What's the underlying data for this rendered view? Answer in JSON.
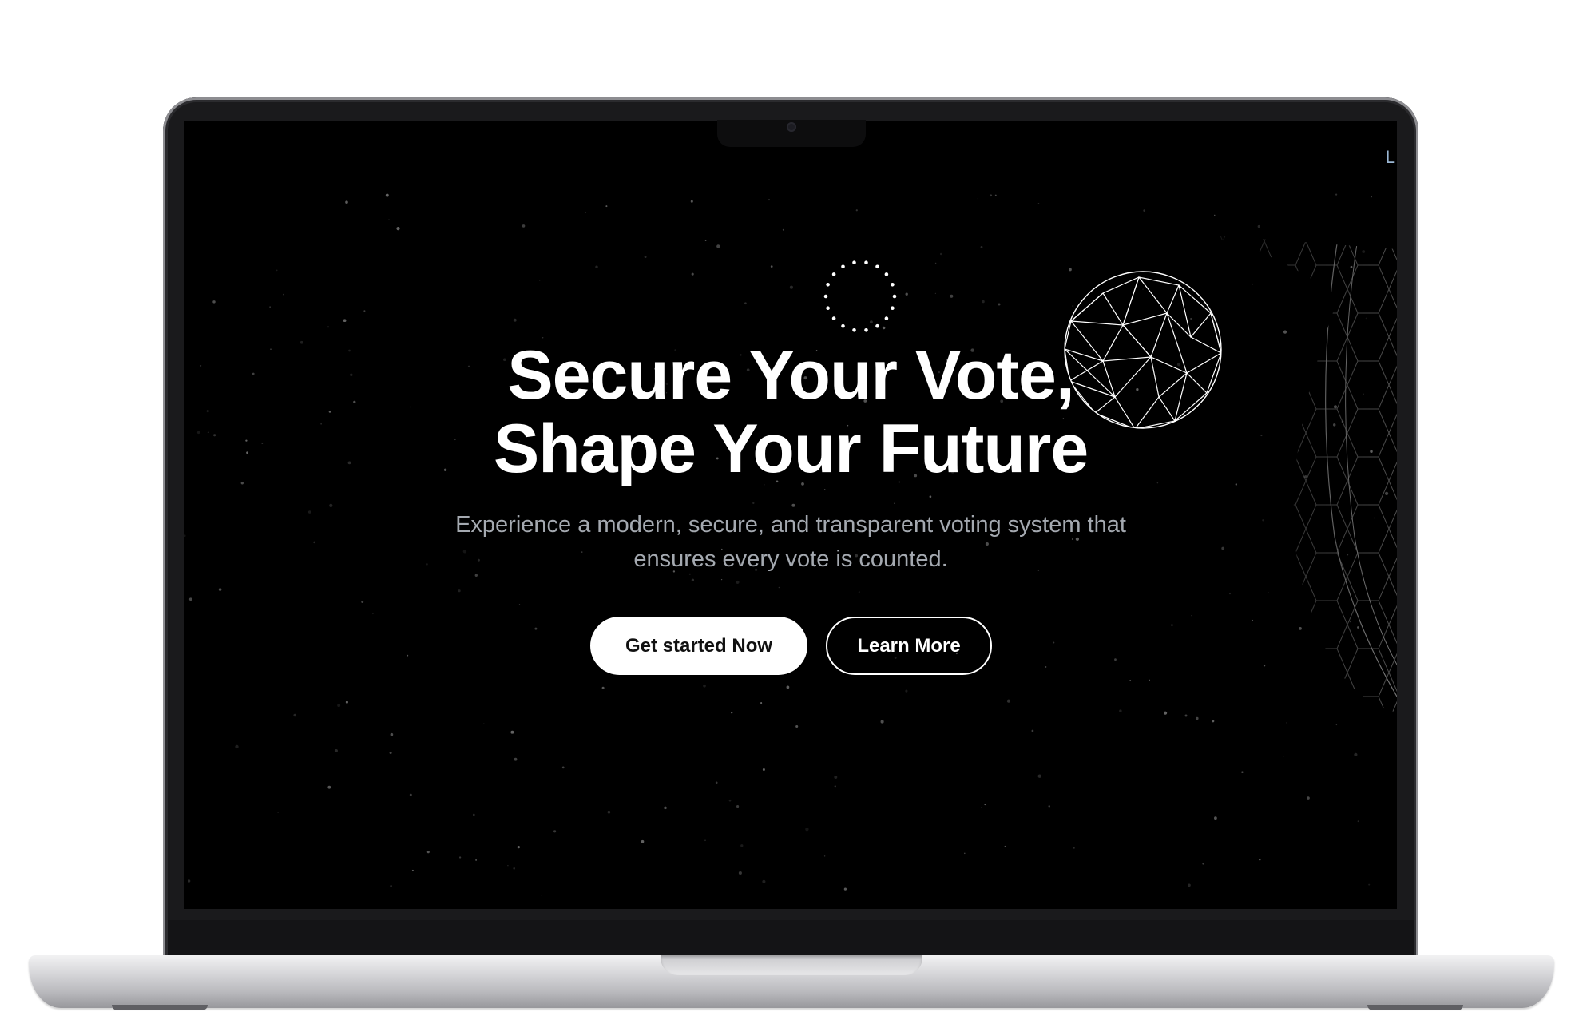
{
  "nav": {
    "corner_letter": "L"
  },
  "hero": {
    "headline_line1": "Secure Your Vote,",
    "headline_line2": "Shape Your Future",
    "subtext_line1": "Experience a modern, secure, and transparent voting system that",
    "subtext_line2": "ensures every vote is counted."
  },
  "buttons": {
    "primary_label": "Get started Now",
    "secondary_label": "Learn More"
  },
  "decorations": {
    "spinner": "loading-ring",
    "globe": "wireframe-globe",
    "mesh": "hexagon-mesh"
  },
  "colors": {
    "background": "#000000",
    "primary_text": "#ffffff",
    "secondary_text": "#a4a9b0",
    "primary_button_bg": "#ffffff",
    "primary_button_text": "#111111",
    "nav_letter": "#9bb7d4"
  }
}
